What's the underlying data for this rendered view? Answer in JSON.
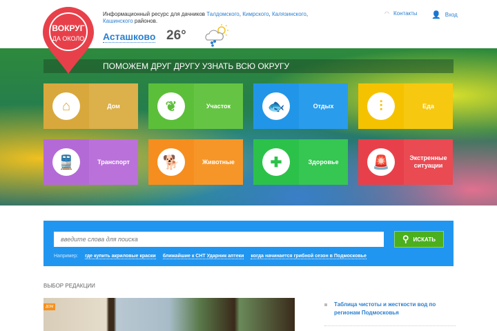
{
  "header": {
    "logo_text": "ВОКРУГ ДА ОКОЛО",
    "info_prefix": "Информационный ресурс для дачников",
    "regions": [
      "Талдомского",
      "Кимрского",
      "Калязинского",
      "Кашинского"
    ],
    "info_suffix": "районов.",
    "city": "Асташково",
    "temperature": "26°",
    "weather_icon": "cloud-sun-rain-icon",
    "contacts": "Контакты",
    "login": "Вход"
  },
  "banner": "ПОМОЖЕМ ДРУГ ДРУГУ УЗНАТЬ ВСЮ ОКРУГУ",
  "categories": [
    {
      "label": "Дом",
      "icon": "house-icon",
      "color": "#d9a83c",
      "color2": "#dcb04a"
    },
    {
      "label": "Участок",
      "icon": "plant-icon",
      "color": "#5cbf3a",
      "color2": "#66c444"
    },
    {
      "label": "Отдых",
      "icon": "fishing-icon",
      "color": "#2196e8",
      "color2": "#2a9cec"
    },
    {
      "label": "Еда",
      "icon": "skewer-icon",
      "color": "#f5c200",
      "color2": "#f7c810"
    },
    {
      "label": "Транспорт",
      "icon": "train-icon",
      "color": "#b46ad6",
      "color2": "#ba72da"
    },
    {
      "label": "Животные",
      "icon": "pets-icon",
      "color": "#f58e1e",
      "color2": "#f79628"
    },
    {
      "label": "Здоровье",
      "icon": "medical-cross-icon",
      "color": "#2cc24a",
      "color2": "#36c652"
    },
    {
      "label": "Экстренные ситуации",
      "icon": "siren-icon",
      "color": "#e8404a",
      "color2": "#ea4a52"
    }
  ],
  "search": {
    "placeholder": "введите слова для поиска",
    "button": "ИСКАТЬ",
    "examples_label": "Например:",
    "examples": [
      "где купить акриловые краски",
      "ближайшие к СНТ Ударник аптеки",
      "когда начинается грибной сезон в Подмосковье"
    ]
  },
  "editors_choice": {
    "title": "ВЫБОР РЕДАКЦИИ",
    "badge": "ДОМ",
    "news": [
      "Таблица чистоты и жесткости вод по регионам Подмосковья"
    ]
  }
}
